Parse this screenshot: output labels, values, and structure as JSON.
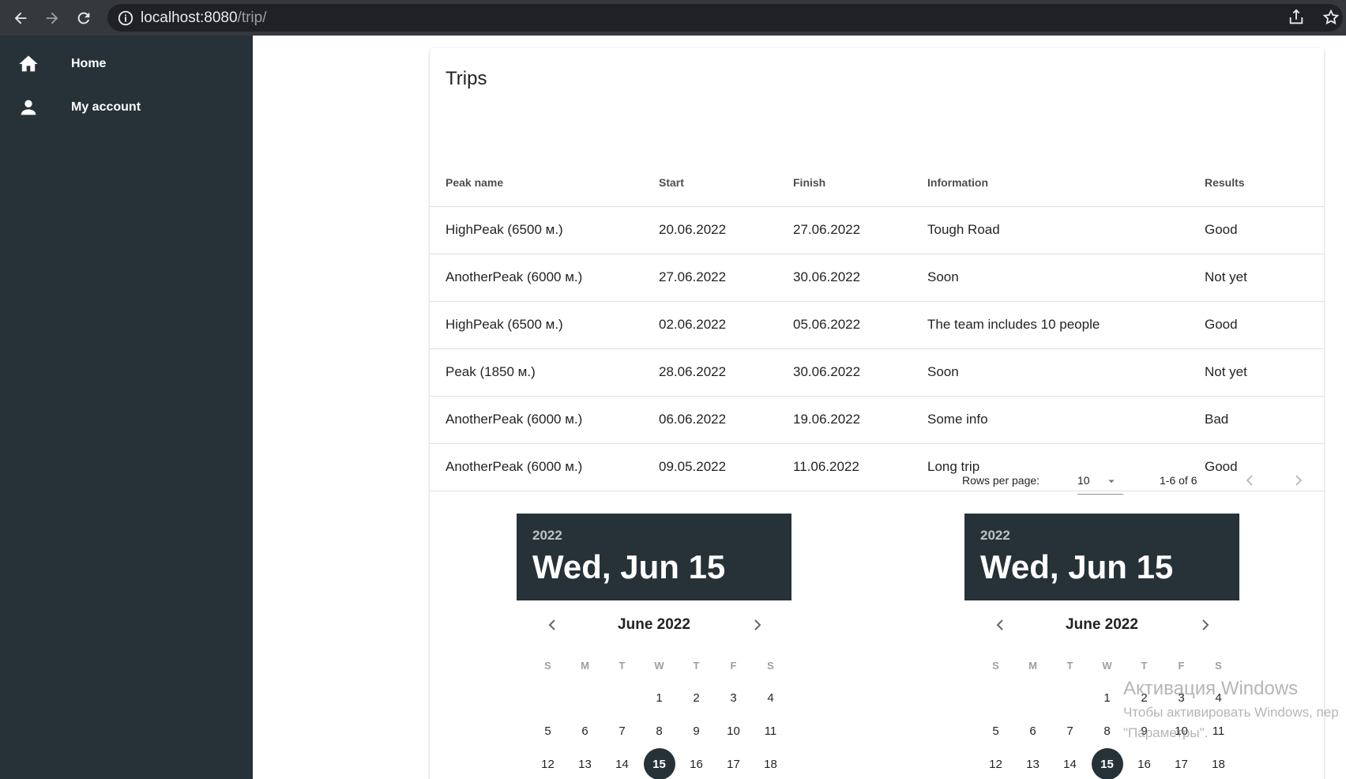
{
  "browser": {
    "url_host": "localhost:8080",
    "url_path": "/trip/"
  },
  "sidebar": {
    "items": [
      {
        "label": "Home",
        "icon": "home-icon"
      },
      {
        "label": "My account",
        "icon": "person-icon"
      }
    ]
  },
  "trips": {
    "title": "Trips",
    "columns": [
      "Peak name",
      "Start",
      "Finish",
      "Information",
      "Results"
    ],
    "rows": [
      [
        "HighPeak (6500 м.)",
        "20.06.2022",
        "27.06.2022",
        "Tough Road",
        "Good"
      ],
      [
        "AnotherPeak (6000 м.)",
        "27.06.2022",
        "30.06.2022",
        "Soon",
        "Not yet"
      ],
      [
        "HighPeak (6500 м.)",
        "02.06.2022",
        "05.06.2022",
        "The team includes 10 people",
        "Good"
      ],
      [
        "Peak (1850 м.)",
        "28.06.2022",
        "30.06.2022",
        "Soon",
        "Not yet"
      ],
      [
        "AnotherPeak (6000 м.)",
        "06.06.2022",
        "19.06.2022",
        "Some info",
        "Bad"
      ],
      [
        "AnotherPeak (6000 м.)",
        "09.05.2022",
        "11.06.2022",
        "Long trip",
        "Good"
      ]
    ],
    "pagination": {
      "rows_per_page_label": "Rows per page:",
      "rows_per_page": "10",
      "range": "1-6 of 6"
    }
  },
  "pickers": [
    {
      "year": "2022",
      "date": "Wed, Jun 15",
      "month_label": "June 2022",
      "dow": [
        "S",
        "M",
        "T",
        "W",
        "T",
        "F",
        "S"
      ],
      "weeks": [
        [
          "",
          "",
          "",
          "1",
          "2",
          "3",
          "4"
        ],
        [
          "5",
          "6",
          "7",
          "8",
          "9",
          "10",
          "11"
        ],
        [
          "12",
          "13",
          "14",
          "15",
          "16",
          "17",
          "18"
        ]
      ],
      "selected": "15"
    },
    {
      "year": "2022",
      "date": "Wed, Jun 15",
      "month_label": "June 2022",
      "dow": [
        "S",
        "M",
        "T",
        "W",
        "T",
        "F",
        "S"
      ],
      "weeks": [
        [
          "",
          "",
          "",
          "1",
          "2",
          "3",
          "4"
        ],
        [
          "5",
          "6",
          "7",
          "8",
          "9",
          "10",
          "11"
        ],
        [
          "12",
          "13",
          "14",
          "15",
          "16",
          "17",
          "18"
        ]
      ],
      "selected": "15"
    }
  ],
  "watermark": {
    "line1": "Активация Windows",
    "line2": "Чтобы активировать Windows, пер",
    "line3": "\"Параметры\"."
  }
}
